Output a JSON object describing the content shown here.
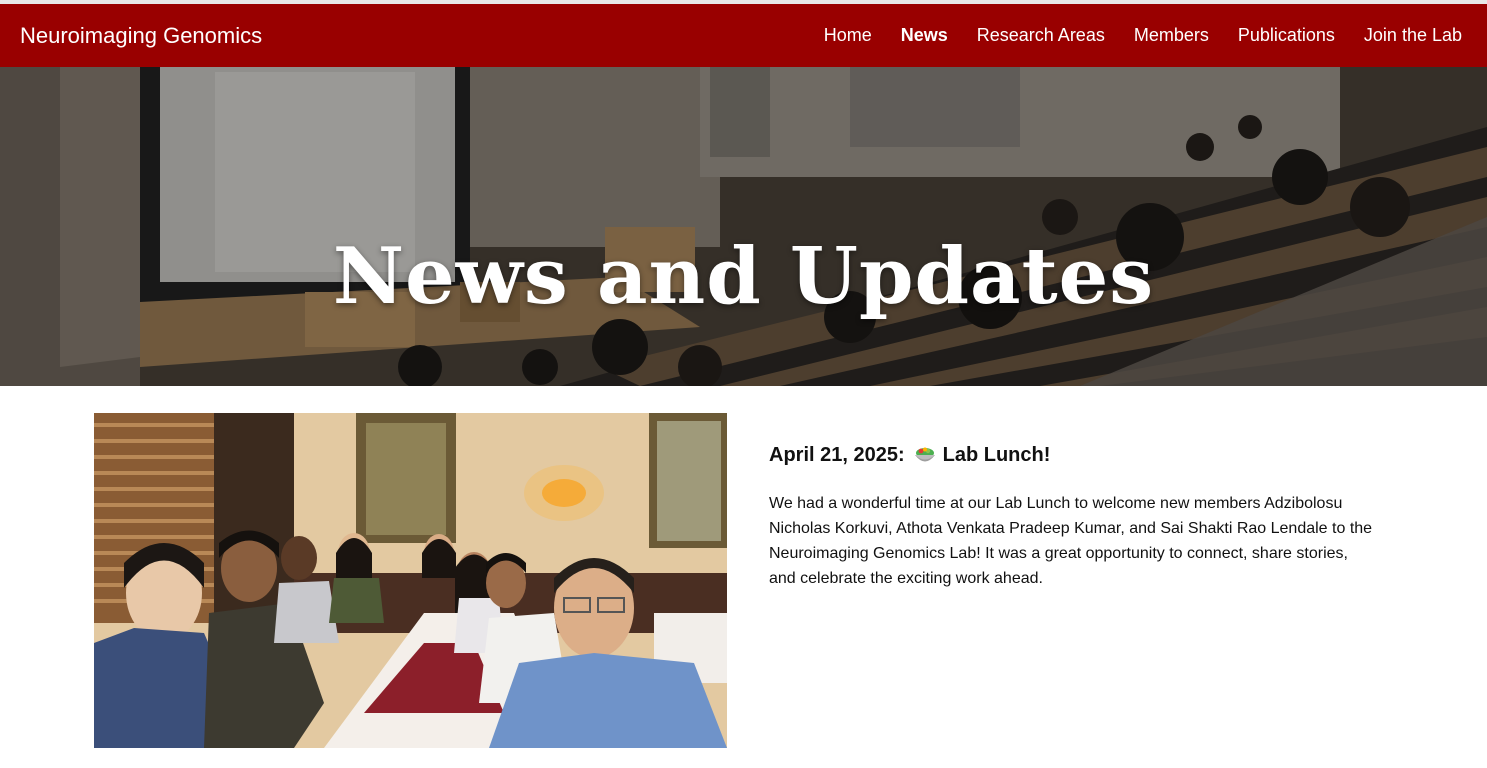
{
  "nav": {
    "brand": "Neuroimaging Genomics",
    "links": [
      {
        "label": "Home",
        "active": false
      },
      {
        "label": "News",
        "active": true
      },
      {
        "label": "Research Areas",
        "active": false
      },
      {
        "label": "Members",
        "active": false
      },
      {
        "label": "Publications",
        "active": false
      },
      {
        "label": "Join the Lab",
        "active": false
      }
    ]
  },
  "hero": {
    "title": "News and Updates"
  },
  "post": {
    "date": "April 21, 2025:",
    "icon": "salad-bowl-icon",
    "title": "Lab Lunch!",
    "body": "We had a wonderful time at our Lab Lunch to welcome new members Adzibolosu Nicholas Korkuvi, Athota Venkata Pradeep Kumar, and Sai Shakti Rao Lendale to the Neuroimaging Genomics Lab! It was a great opportunity to connect, share stories, and celebrate the exciting work ahead."
  },
  "colors": {
    "nav_bg": "#990000",
    "nav_text": "#ffffff",
    "body_text": "#111111"
  }
}
